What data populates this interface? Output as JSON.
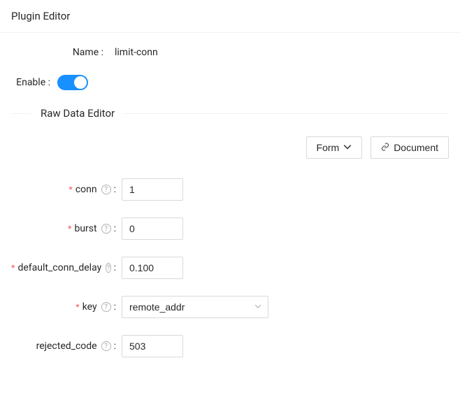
{
  "header": {
    "title": "Plugin Editor"
  },
  "form": {
    "name_label": "Name",
    "name_value": "limit-conn",
    "enable_label": "Enable",
    "enable_value": true
  },
  "section": {
    "title": "Raw Data Editor"
  },
  "actions": {
    "form_label": "Form",
    "document_label": "Document"
  },
  "fields": {
    "conn": {
      "label": "conn",
      "value": "1",
      "required": true
    },
    "burst": {
      "label": "burst",
      "value": "0",
      "required": true
    },
    "delay": {
      "label": "default_conn_delay",
      "value": "0.100",
      "required": true
    },
    "key": {
      "label": "key",
      "value": "remote_addr",
      "required": true
    },
    "rej": {
      "label": "rejected_code",
      "value": "503",
      "required": false
    }
  },
  "chart_data": null
}
